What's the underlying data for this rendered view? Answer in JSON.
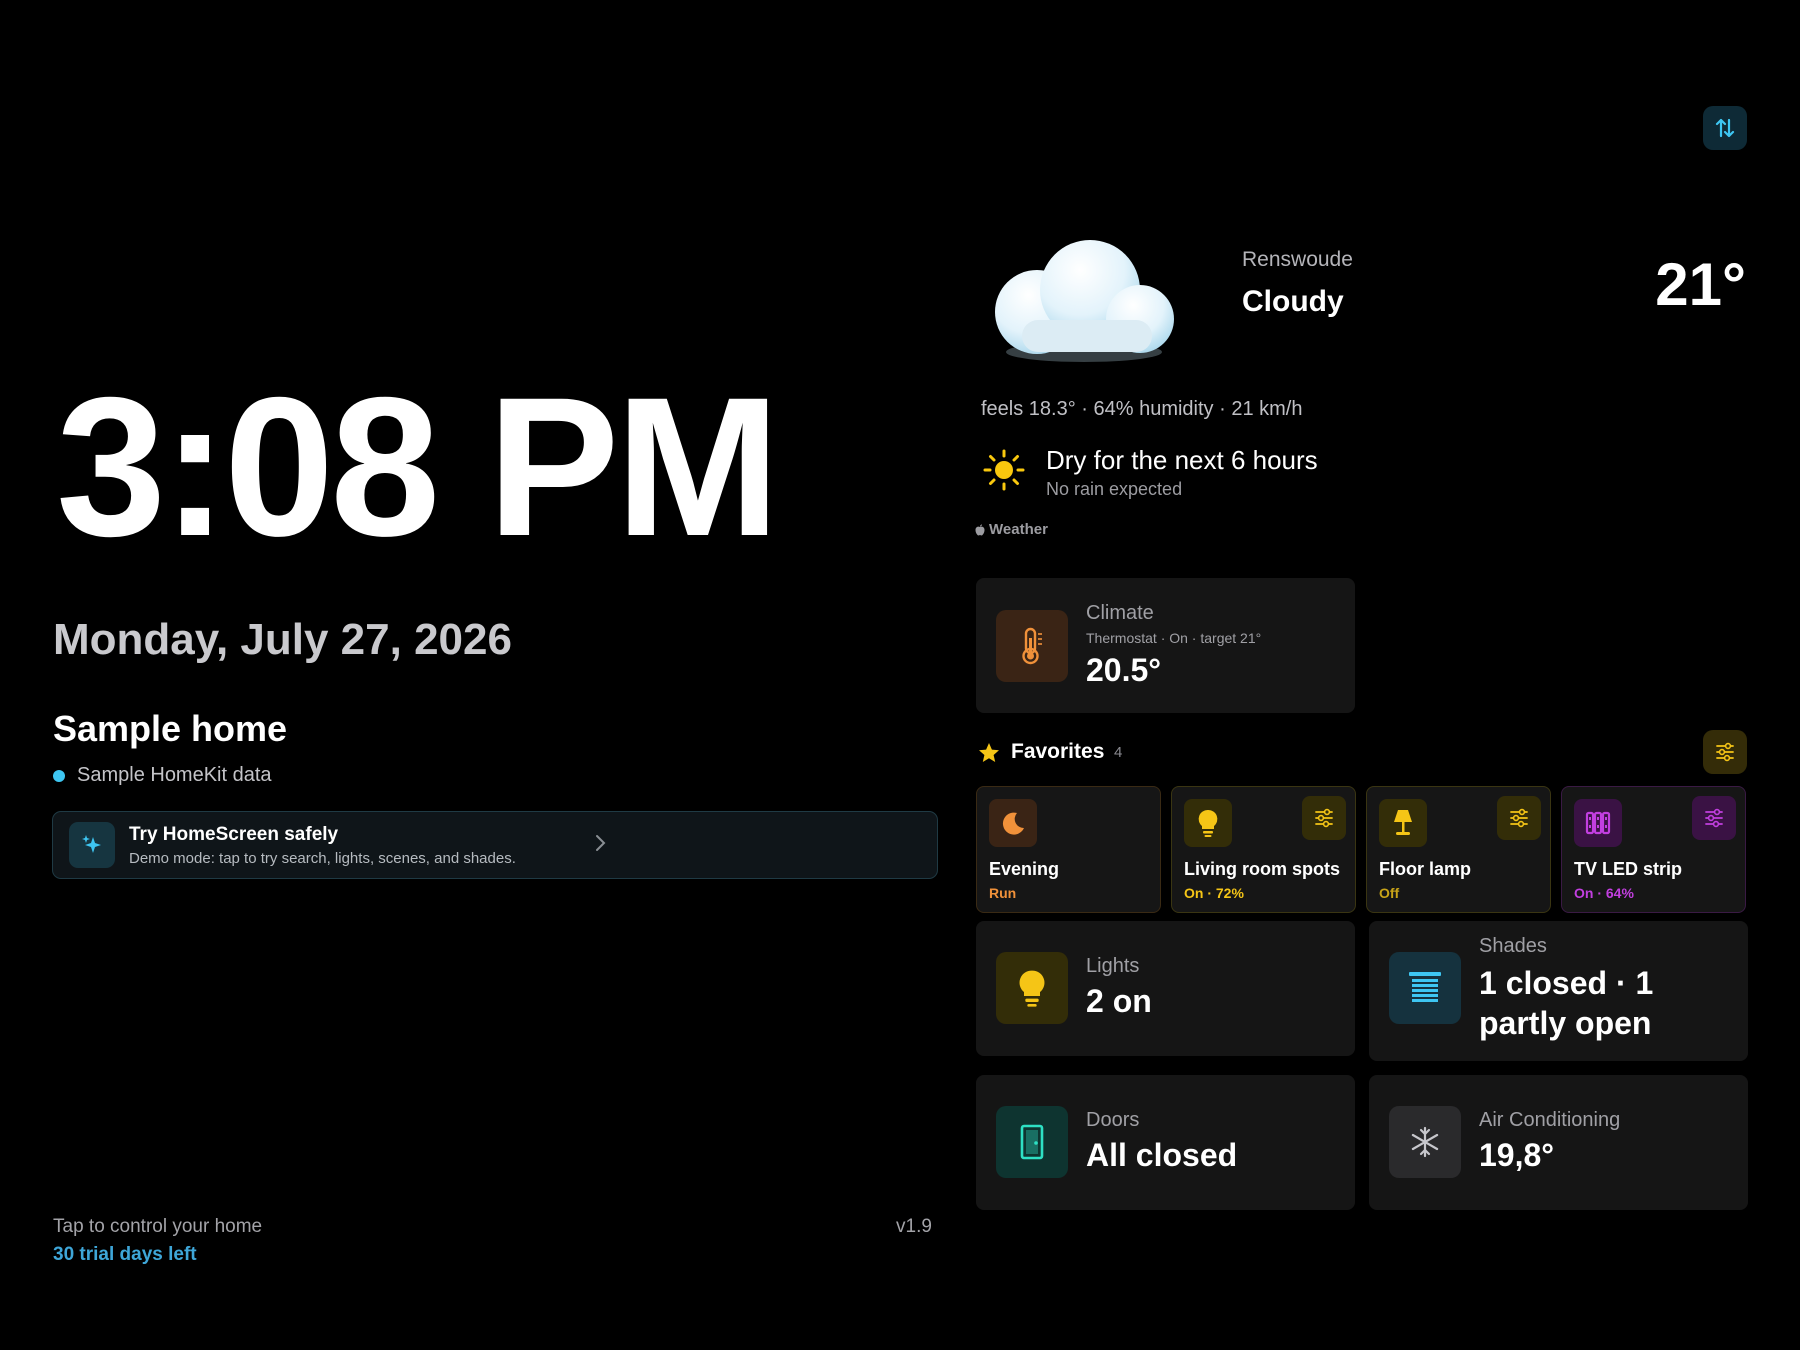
{
  "clock": {
    "time": "3:08 PM",
    "date": "Monday, July 27, 2026"
  },
  "home": {
    "name": "Sample home",
    "source": "Sample HomeKit data",
    "source_dot_color": "#3ec6f2"
  },
  "demo_banner": {
    "title": "Try HomeScreen safely",
    "subtitle": "Demo mode: tap to try search, lights, scenes, and shades.",
    "icon": "sparkles-icon"
  },
  "footer": {
    "hint": "Tap to control your home",
    "trial": "30 trial days left",
    "version": "v1.9"
  },
  "weather": {
    "location": "Renswoude",
    "condition": "Cloudy",
    "temperature": "21°",
    "details": "feels 18.3° · 64% humidity · 21 km/h",
    "forecast_title": "Dry for the next 6 hours",
    "forecast_sub": "No rain expected",
    "credit": "Weather",
    "icon": "cloud-icon",
    "forecast_icon": "sun-icon"
  },
  "climate": {
    "label": "Climate",
    "sub": "Thermostat · On · target 21°",
    "value": "20.5°",
    "icon": "thermometer-icon"
  },
  "favorites": {
    "title": "Favorites",
    "count": "4",
    "items": [
      {
        "name": "Evening",
        "state": "Run",
        "icon": "moon-icon",
        "color": "#f0913a"
      },
      {
        "name": "Living room spots",
        "state": "On · 72%",
        "icon": "lightbulb-icon",
        "color": "#f5c516"
      },
      {
        "name": "Floor lamp",
        "state": "Off",
        "icon": "lamp-icon",
        "color": "#c9a418"
      },
      {
        "name": "TV LED strip",
        "state": "On · 64%",
        "icon": "led-strip-icon",
        "color": "#c23fe0"
      }
    ]
  },
  "summary": {
    "lights": {
      "label": "Lights",
      "value": "2 on",
      "icon": "lightbulb-icon"
    },
    "shades": {
      "label": "Shades",
      "line1": "1 closed · 1",
      "line2": "partly open",
      "icon": "blinds-icon"
    },
    "doors": {
      "label": "Doors",
      "value": "All closed",
      "icon": "door-icon"
    },
    "ac": {
      "label": "Air Conditioning",
      "value": "19,8°",
      "icon": "snowflake-icon"
    }
  },
  "colors": {
    "accent": "#3ec6f2",
    "trial": "#3ea6d8",
    "favorites_accent": "#f5c516"
  }
}
